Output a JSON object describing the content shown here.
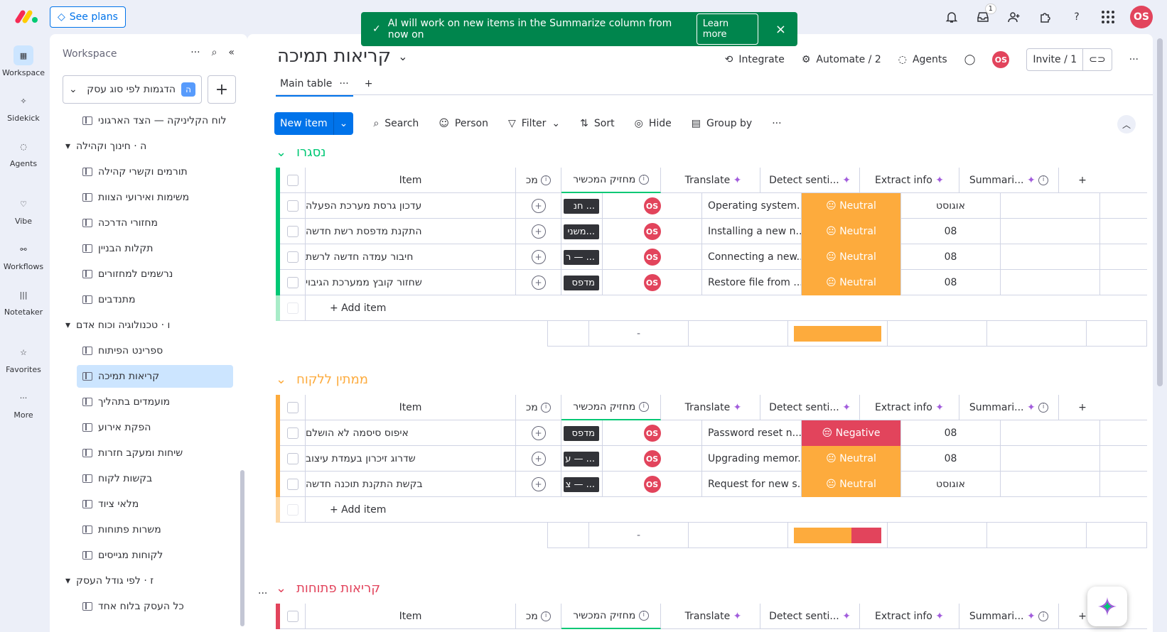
{
  "topbar": {
    "see_plans": "See plans",
    "inbox_badge": "1",
    "user_initials": "OS"
  },
  "toast": {
    "message": "AI will work on new items in the Summarize column from now on",
    "learn_more": "Learn more"
  },
  "leftnav": [
    {
      "label": "Workspace",
      "icon": "grid-icon"
    },
    {
      "label": "Sidekick",
      "icon": "sidekick-icon"
    },
    {
      "label": "Agents",
      "icon": "agents-icon"
    },
    {
      "label": "Vibe",
      "icon": "vibe-icon"
    },
    {
      "label": "Workflows",
      "icon": "workflows-icon"
    },
    {
      "label": "Notetaker",
      "icon": "notetaker-icon"
    },
    {
      "label": "Favorites",
      "icon": "star-icon"
    },
    {
      "label": "More",
      "icon": "more-icon"
    }
  ],
  "sidebar": {
    "header": "Workspace",
    "workspace_name": "הדגמות לפי סוג עסק",
    "workspace_badge": "ה",
    "items": [
      {
        "type": "board",
        "label": "לוח הקליניקה — הצד הארגוני"
      },
      {
        "type": "folder",
        "label": "ה · חינוך וקהילה"
      },
      {
        "type": "board",
        "label": "תורמים וקשרי קהילה"
      },
      {
        "type": "board",
        "label": "משימות ואירועי הצוות"
      },
      {
        "type": "board",
        "label": "מחזורי הדרכה"
      },
      {
        "type": "board",
        "label": "תקלות הבניין"
      },
      {
        "type": "board",
        "label": "נרשמים למחזורים"
      },
      {
        "type": "board",
        "label": "מתנדבים"
      },
      {
        "type": "folder",
        "label": "ו · טכנולוגיה וכוח אדם"
      },
      {
        "type": "board",
        "label": "ספרינט הפיתוח"
      },
      {
        "type": "board",
        "label": "קריאות תמיכה",
        "active": true
      },
      {
        "type": "board",
        "label": "מועמדים בתהליך"
      },
      {
        "type": "board",
        "label": "הפקת אירוע"
      },
      {
        "type": "board",
        "label": "שיחות ומעקב חזרות"
      },
      {
        "type": "board",
        "label": "בקשות לקוח"
      },
      {
        "type": "board",
        "label": "מלאי ציוד"
      },
      {
        "type": "board",
        "label": "משרות פתוחות"
      },
      {
        "type": "board",
        "label": "לקוחות מגייסים"
      },
      {
        "type": "folder",
        "label": "ז · לפי גודל העסק"
      },
      {
        "type": "board",
        "label": "כל העסק בלוח אחד"
      }
    ]
  },
  "board": {
    "title": "קריאות תמיכה",
    "integrate": "Integrate",
    "automate": "Automate / 2",
    "agents": "Agents",
    "invite": "Invite / 1",
    "tab_main": "Main table",
    "toolbar": {
      "new_item": "New item",
      "search": "Search",
      "person": "Person",
      "filter": "Filter",
      "sort": "Sort",
      "hide": "Hide",
      "group_by": "Group by"
    },
    "columns": {
      "item": "Item",
      "tech": "מכ",
      "owner": "מחזיק המכשיר",
      "translate": "Translate",
      "detect": "Detect senti...",
      "extract": "Extract info",
      "summarize": "Summari..."
    },
    "add_item": "+ Add item",
    "dash": "-",
    "groups": [
      {
        "title": "נסגרו",
        "color": "#00c875",
        "rows": [
          {
            "item": "עדכון גרסת מערכת הפעלה",
            "tech": "... חנ",
            "owner": "OS",
            "translate": "Operating system...",
            "sentiment": "Neutral",
            "extract": "אוגוסט"
          },
          {
            "item": "התקנת מדפסת רשת חדשה",
            "tech": "...משני",
            "owner": "OS",
            "translate": "Installing a new n...",
            "sentiment": "Neutral",
            "extract": "08"
          },
          {
            "item": "חיבור עמדה חדשה לרשת",
            "tech": "... — ר",
            "owner": "OS",
            "translate": "Connecting a new...",
            "sentiment": "Neutral",
            "extract": "08"
          },
          {
            "item": "שחזור קובץ ממערכת הגיבוי",
            "tech": "מדפס",
            "owner": "OS",
            "translate": "Restore file from ...",
            "sentiment": "Neutral",
            "extract": "08"
          }
        ]
      },
      {
        "title": "ממתין ללקוח",
        "color": "#fdab3d",
        "rows": [
          {
            "item": "איפוס סיסמה לא הושלם",
            "tech": "מדפס",
            "owner": "OS",
            "translate": "Password reset n...",
            "sentiment": "Negative",
            "extract": "08"
          },
          {
            "item": "שדרוג זיכרון בעמדת עיצוב",
            "tech": "... — ע",
            "owner": "OS",
            "translate": "Upgrading memor...",
            "sentiment": "Neutral",
            "extract": "08"
          },
          {
            "item": "בקשת התקנת תוכנה חדשה",
            "tech": "... — צ",
            "owner": "OS",
            "translate": "Request for new s...",
            "sentiment": "Neutral",
            "extract": "אוגוסט"
          }
        ]
      },
      {
        "title": "קריאות פתוחות",
        "color": "#e2445c",
        "rows": []
      }
    ]
  }
}
